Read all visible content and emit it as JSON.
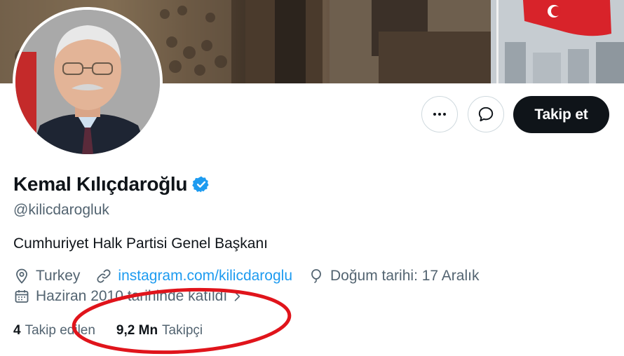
{
  "profile": {
    "display_name": "Kemal Kılıçdaroğlu",
    "handle": "@kilicdarogluk",
    "bio": "Cumhuriyet Halk Partisi Genel Başkanı",
    "location": "Turkey",
    "website": "instagram.com/kilicdaroglu",
    "birthday": "Doğum tarihi: 17 Aralık",
    "joined": "Haziran 2010 tarihinde katıldı"
  },
  "actions": {
    "more_icon": "ellipsis-icon",
    "message_icon": "message-icon",
    "follow_label": "Takip et"
  },
  "counts": {
    "following_value": "4",
    "following_label": "Takip edilen",
    "followers_value": "9,2 Mn",
    "followers_label": "Takipçi"
  },
  "colors": {
    "accent": "#1d9bf0",
    "annotation": "#e0141b",
    "follow_button": "#0f1419"
  }
}
